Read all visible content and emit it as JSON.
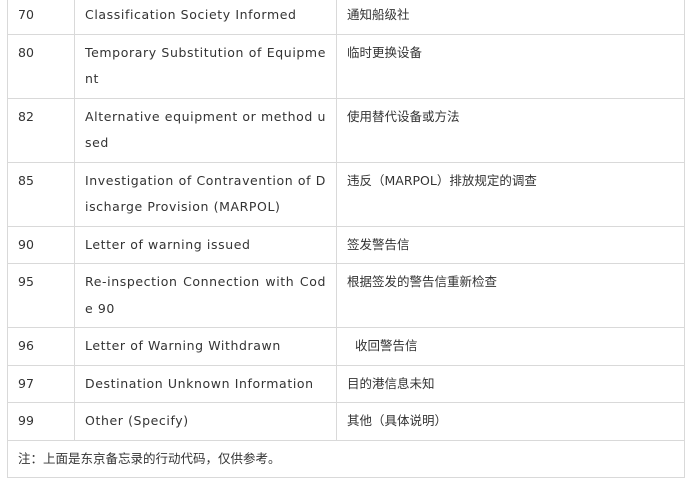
{
  "table": {
    "rows": [
      {
        "code": "70",
        "english": "Classification Society Informed",
        "chinese": "通知船级社"
      },
      {
        "code": "80",
        "english": "Temporary Substitution of Equipment",
        "chinese": "临时更换设备"
      },
      {
        "code": "82",
        "english": "Alternative equipment  or method used",
        "chinese": "使用替代设备或方法"
      },
      {
        "code": "85",
        "english": "Investigation of Contravention of Discharge Provision (MARPOL)",
        "chinese": "违反（MARPOL）排放规定的调查"
      },
      {
        "code": "90",
        "english": "Letter of  warning  issued",
        "chinese": "签发警告信"
      },
      {
        "code": "95",
        "english": "Re-inspection Connection with  Code  90",
        "chinese": "根据签发的警告信重新检查"
      },
      {
        "code": "96",
        "english": "Letter of Warning Withdrawn",
        "chinese": "  收回警告信"
      },
      {
        "code": "97",
        "english": "Destination  Unknown  Information",
        "chinese": "目的港信息未知"
      },
      {
        "code": "99",
        "english": "Other (Specify)",
        "chinese": "其他（具体说明）"
      }
    ],
    "note": "注：上面是东京备忘录的行动代码，仅供参考。"
  }
}
